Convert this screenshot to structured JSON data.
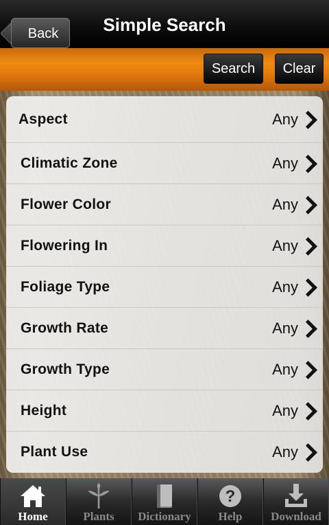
{
  "header": {
    "back_label": "Back",
    "title": "Simple Search"
  },
  "toolbar": {
    "search_label": "Search",
    "clear_label": "Clear",
    "accent_color": "#f08a12"
  },
  "criteria": [
    {
      "label": "Aspect",
      "value": "Any"
    },
    {
      "label": "Climatic Zone",
      "value": "Any"
    },
    {
      "label": "Flower Color",
      "value": "Any"
    },
    {
      "label": "Flowering In",
      "value": "Any"
    },
    {
      "label": "Foliage Type",
      "value": "Any"
    },
    {
      "label": "Growth Rate",
      "value": "Any"
    },
    {
      "label": "Growth Type",
      "value": "Any"
    },
    {
      "label": "Height",
      "value": "Any"
    },
    {
      "label": "Plant Use",
      "value": "Any"
    }
  ],
  "tabs": [
    {
      "label": "Home",
      "icon": "home-icon",
      "active": true
    },
    {
      "label": "Plants",
      "icon": "plant-icon",
      "active": false
    },
    {
      "label": "Dictionary",
      "icon": "book-icon",
      "active": false
    },
    {
      "label": "Help",
      "icon": "help-icon",
      "active": false
    },
    {
      "label": "Download",
      "icon": "download-icon",
      "active": false
    }
  ]
}
